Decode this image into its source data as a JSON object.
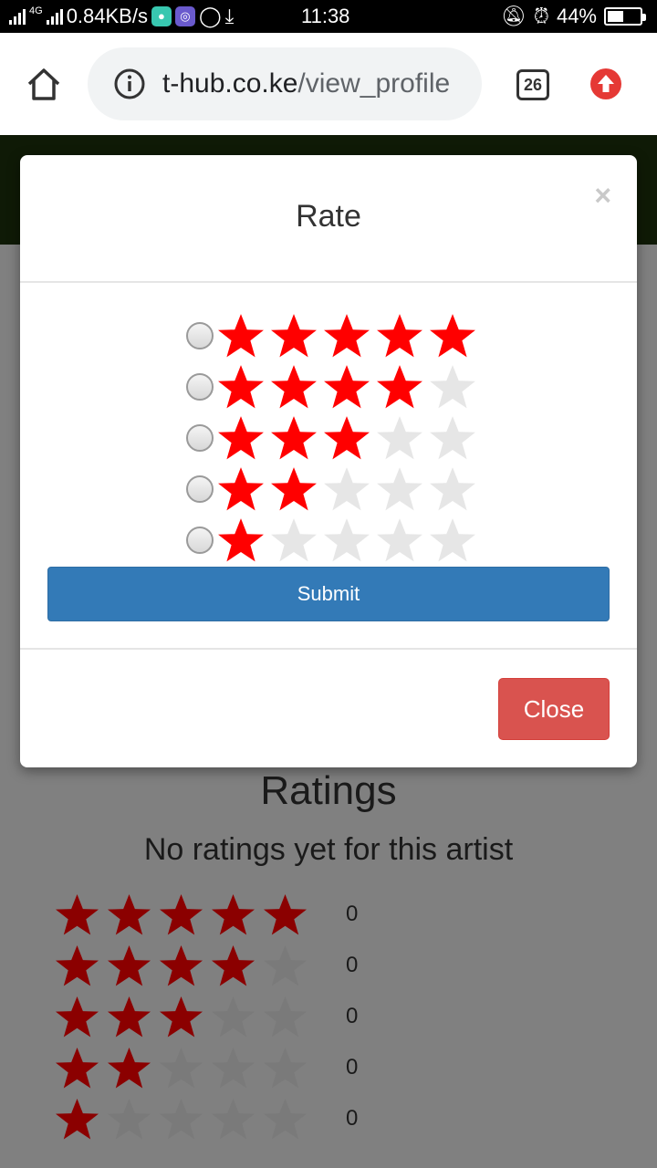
{
  "status_bar": {
    "network": "4G",
    "speed": "0.84KB/s",
    "time": "11:38",
    "battery": "44%",
    "battery_level": 0.44
  },
  "browser": {
    "url_host": "t-hub.co.ke",
    "url_path": "/view_profile",
    "tab_count": "26"
  },
  "modal": {
    "title": "Rate",
    "close_symbol": "×",
    "options": [
      {
        "stars": 5
      },
      {
        "stars": 4
      },
      {
        "stars": 3
      },
      {
        "stars": 2
      },
      {
        "stars": 1
      }
    ],
    "submit_label": "Submit",
    "close_label": "Close"
  },
  "ratings": {
    "title": "Ratings",
    "subtitle": "No ratings yet for this artist",
    "rows": [
      {
        "stars": 5,
        "count": "0"
      },
      {
        "stars": 4,
        "count": "0"
      },
      {
        "stars": 3,
        "count": "0"
      },
      {
        "stars": 2,
        "count": "0"
      },
      {
        "stars": 1,
        "count": "0"
      }
    ]
  },
  "colors": {
    "star_filled": "#ff0000",
    "star_empty": "#e6e6e6",
    "bg_star_filled": "#8b0000",
    "bg_star_empty": "#7a7a7a",
    "submit": "#337ab7",
    "close": "#d9534f",
    "overlay": "#808080"
  }
}
